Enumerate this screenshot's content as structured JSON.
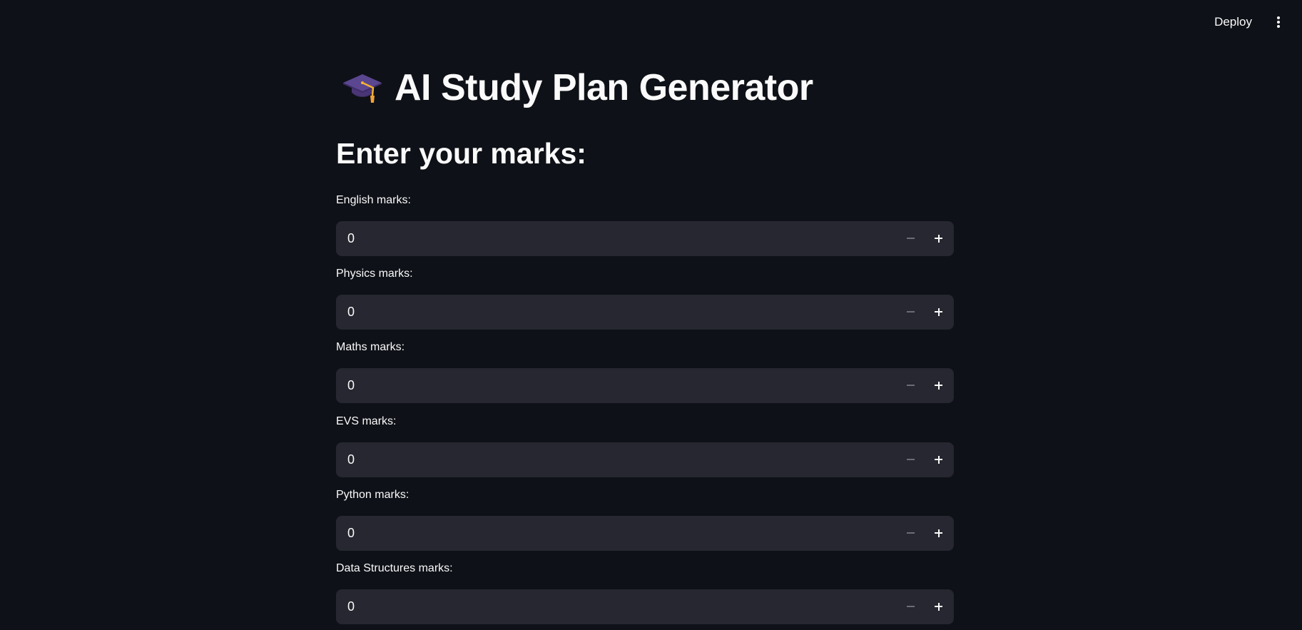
{
  "header": {
    "deploy_label": "Deploy",
    "menu_icon": "vertical-ellipsis-icon"
  },
  "main": {
    "title": "AI Study Plan Generator",
    "title_icon": "graduation-cap-icon",
    "section_heading": "Enter your marks:",
    "fields": [
      {
        "label": "English marks:",
        "value": "0"
      },
      {
        "label": "Physics marks:",
        "value": "0"
      },
      {
        "label": "Maths marks:",
        "value": "0"
      },
      {
        "label": "EVS marks:",
        "value": "0"
      },
      {
        "label": "Python marks:",
        "value": "0"
      },
      {
        "label": "Data Structures marks:",
        "value": "0"
      }
    ]
  },
  "colors": {
    "background": "#0e1117",
    "input_background": "#262730",
    "text": "#fafafa",
    "disabled_icon": "#6b6d76"
  }
}
